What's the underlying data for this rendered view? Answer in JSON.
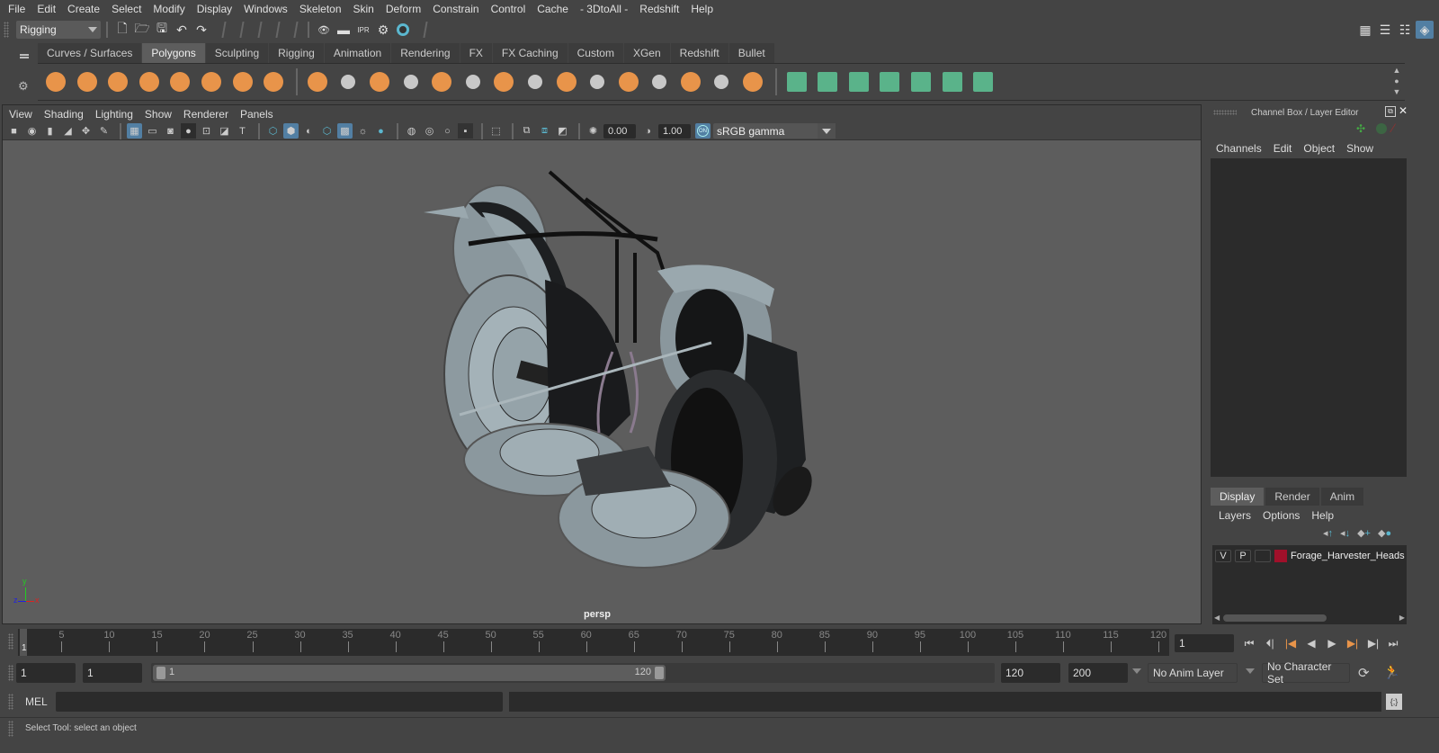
{
  "menubar": [
    "File",
    "Edit",
    "Create",
    "Select",
    "Modify",
    "Display",
    "Windows",
    "Skeleton",
    "Skin",
    "Deform",
    "Constrain",
    "Control",
    "Cache",
    "- 3DtoAll -",
    "Redshift",
    "Help"
  ],
  "statusline": {
    "menu_set": "Rigging",
    "icons": [
      "new-scene-icon",
      "open-scene-icon",
      "save-scene-icon",
      "undo-icon",
      "redo-icon",
      "render-view-icon",
      "render-current-icon",
      "ipr-render-icon",
      "render-settings-icon",
      "hypershade-icon"
    ],
    "right_icons": [
      "modeling-toolkit-icon",
      "attribute-editor-icon",
      "tool-settings-icon",
      "channel-box-icon"
    ]
  },
  "shelf": {
    "tabs": [
      "Curves / Surfaces",
      "Polygons",
      "Sculpting",
      "Rigging",
      "Animation",
      "Rendering",
      "FX",
      "FX Caching",
      "Custom",
      "XGen",
      "Redshift",
      "Bullet"
    ],
    "active_tab": "Polygons",
    "orange_icons": [
      "poly-sphere-icon",
      "poly-cube-icon",
      "poly-cylinder-icon",
      "poly-cone-icon",
      "poly-plane-icon",
      "poly-torus-icon",
      "poly-pyramid-icon",
      "poly-pipe-icon"
    ],
    "tool_icons": [
      "combine-icon",
      "separate-icon",
      "mirror-icon",
      "smooth-icon",
      "bevel-icon",
      "extrude-icon",
      "multi-cut-icon",
      "bridge-icon",
      "target-weld-icon",
      "append-polygon-icon",
      "insert-edge-loop-icon",
      "offset-edge-loop-icon",
      "fill-hole-icon",
      "quad-draw-icon",
      "boolean-icon"
    ],
    "uv_icons": [
      "planar-uv-icon",
      "cylindrical-uv-icon",
      "spherical-uv-icon",
      "automatic-uv-icon",
      "unfold-uv-icon",
      "uv-editor-icon",
      "layout-uv-icon"
    ]
  },
  "viewport": {
    "menu": [
      "View",
      "Shading",
      "Lighting",
      "Show",
      "Renderer",
      "Panels"
    ],
    "exposure": "0.00",
    "gamma": "1.00",
    "color_mgmt_badge": "ON",
    "color_space": "sRGB gamma",
    "camera_label": "persp",
    "axis": {
      "x": "x",
      "y": "y",
      "z": "z"
    }
  },
  "right_panel": {
    "title": "Channel Box / Layer Editor",
    "channel_menu": [
      "Channels",
      "Edit",
      "Object",
      "Show"
    ],
    "layer_tabs": [
      "Display",
      "Render",
      "Anim"
    ],
    "active_layer_tab": "Display",
    "layer_menu": [
      "Layers",
      "Options",
      "Help"
    ],
    "layers": [
      {
        "visible": "V",
        "playback": "P",
        "color": "#a0102a",
        "name": "Forage_Harvester_Heads"
      }
    ]
  },
  "timeline": {
    "ticks": [
      5,
      10,
      15,
      20,
      25,
      30,
      35,
      40,
      45,
      50,
      55,
      60,
      65,
      70,
      75,
      80,
      85,
      90,
      95,
      100,
      105,
      110,
      115,
      120
    ],
    "start_label": "1",
    "current_frame": "1",
    "range_max": 120
  },
  "range": {
    "anim_start": "1",
    "playback_start": "1",
    "slider_start": "1",
    "slider_end": "120",
    "playback_end": "120",
    "anim_end": "200",
    "anim_layer": "No Anim Layer",
    "character_set": "No Character Set"
  },
  "command": {
    "label": "MEL",
    "help_text": "Select Tool: select an object"
  }
}
